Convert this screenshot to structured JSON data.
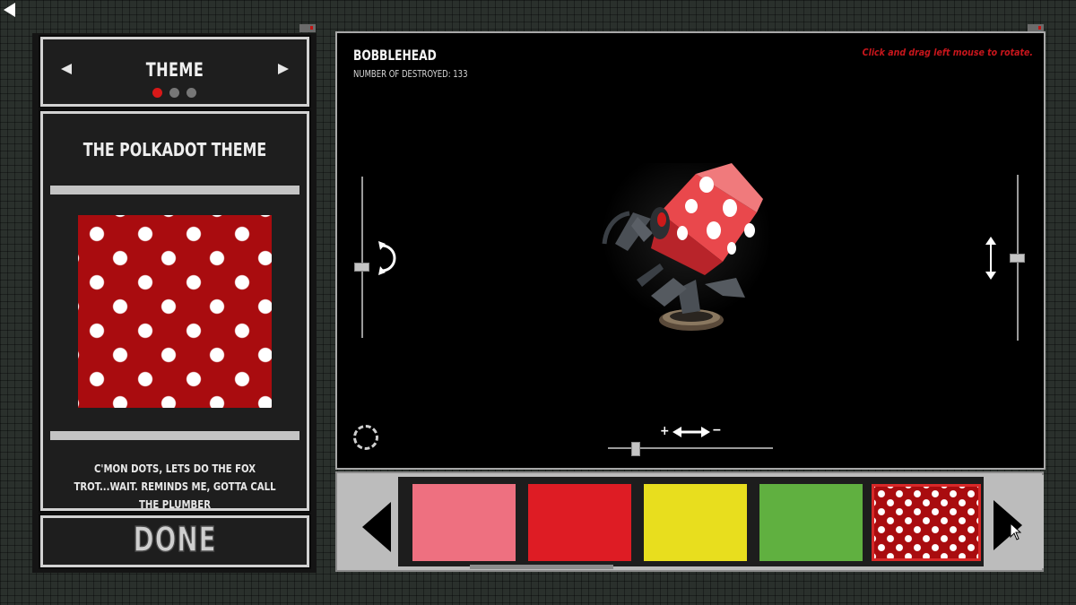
{
  "left_panel": {
    "header": {
      "title": "THEME",
      "page_dots": [
        {
          "color": "#d81818",
          "active": true
        },
        {
          "color": "#777777",
          "active": false
        },
        {
          "color": "#777777",
          "active": false
        }
      ]
    },
    "theme": {
      "name": "THE POLKADOT THEME",
      "description": "C'MON DOTS, LETS DO THE FOX TROT...WAIT.  REMINDS ME, GOTTA CALL THE PLUMBER",
      "preview_colors": {
        "base": "#a90c0f",
        "dots": "#ffffff"
      }
    },
    "done_label": "DONE"
  },
  "viewer": {
    "model_name": "BOBBLEHEAD",
    "destroyed_label": "NUMBER OF DESTROYED: 133",
    "rotate_hint": "Click and drag left mouse to rotate.",
    "zoom_plus": "+",
    "zoom_minus": "−"
  },
  "swatches": [
    {
      "name": "pink",
      "color": "#ee7080",
      "selected": false
    },
    {
      "name": "red",
      "color": "#de1c24",
      "selected": false
    },
    {
      "name": "yellow",
      "color": "#e8de1e",
      "selected": false
    },
    {
      "name": "green",
      "color": "#60b040",
      "selected": false
    },
    {
      "name": "polkadot",
      "color": "#a90c0f",
      "selected": true
    }
  ],
  "colors": {
    "accent_red": "#c8161c",
    "frame_gray": "#d2d2d2",
    "viewer_bg": "#000000"
  }
}
